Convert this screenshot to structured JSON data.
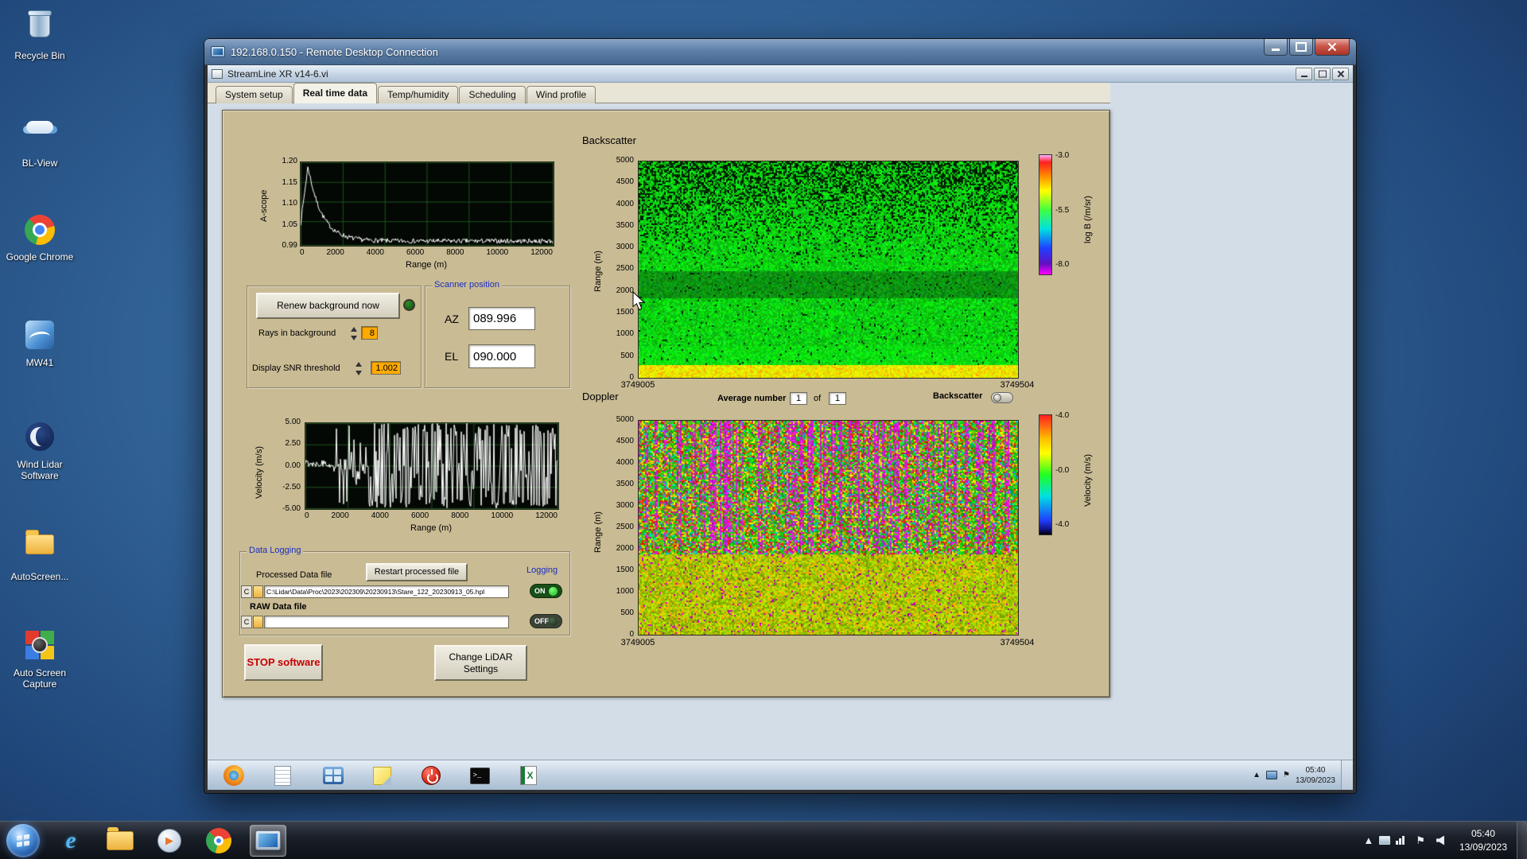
{
  "desktop": {
    "icons": [
      {
        "label": "Recycle Bin"
      },
      {
        "label": "BL-View"
      },
      {
        "label": "Google Chrome"
      },
      {
        "label": "MW41"
      },
      {
        "label": "Wind Lidar Software"
      },
      {
        "label": "AutoScreen..."
      },
      {
        "label": "Auto Screen Capture"
      }
    ]
  },
  "rdp_window": {
    "title": "192.168.0.150 - Remote Desktop Connection"
  },
  "vi_window": {
    "title": "StreamLine XR v14-6.vi",
    "tabs": [
      {
        "label": "System setup"
      },
      {
        "label": "Real time data",
        "active": true
      },
      {
        "label": "Temp/humidity"
      },
      {
        "label": "Scheduling"
      },
      {
        "label": "Wind profile"
      }
    ]
  },
  "background_controls": {
    "renew_button": "Renew background now",
    "rays_label": "Rays in background",
    "rays_value": "8",
    "snr_label": "Display SNR threshold",
    "snr_value": "1.002"
  },
  "scanner": {
    "title": "Scanner position",
    "az_label": "AZ",
    "az_value": "089.996",
    "el_label": "EL",
    "el_value": "090.000"
  },
  "data_logging": {
    "title": "Data Logging",
    "processed_label": "Processed Data file",
    "restart_button": "Restart processed file",
    "logging_label": "Logging",
    "drive_letter": "C",
    "processed_path": "C:\\Lidar\\Data\\Proc\\2023\\202309\\20230913\\Stare_122_20230913_05.hpl",
    "on_label": "ON",
    "raw_label": "RAW Data file",
    "raw_path": "",
    "off_label": "OFF"
  },
  "action_buttons": {
    "stop": "STOP software",
    "change_settings": "Change LiDAR Settings"
  },
  "doppler_header": {
    "average_label": "Average number",
    "average_value": "1",
    "of_label": "of",
    "of_value": "1",
    "backscatter_label": "Backscatter"
  },
  "chart_data": [
    {
      "type": "line",
      "title": "A-scope",
      "ylabel": "A-scope",
      "xlabel": "Range (m)",
      "xlim": [
        0,
        12000
      ],
      "ylim": [
        0.99,
        1.2
      ],
      "xticks": [
        "0",
        "2000",
        "4000",
        "6000",
        "8000",
        "10000",
        "12000"
      ],
      "yticks": [
        "1.20",
        "1.15",
        "1.10",
        "1.05",
        "0.99"
      ],
      "grid": true,
      "series": [
        {
          "name": "a-scope-trace",
          "color": "#ffffff",
          "description": "Rises from ~1.05 at 0 m to a peak of ~1.19 near 400 m, decays to a noisy ~1.00 baseline beyond 3000 m"
        }
      ]
    },
    {
      "type": "line",
      "title": "Velocity",
      "ylabel": "Velocity (m/s)",
      "xlabel": "Range (m)",
      "xlim": [
        0,
        12000
      ],
      "ylim": [
        -5,
        5
      ],
      "xticks": [
        "0",
        "2000",
        "4000",
        "6000",
        "8000",
        "10000",
        "12000"
      ],
      "yticks": [
        "5.00",
        "2.50",
        "0.00",
        "-2.50",
        "-5.00"
      ],
      "grid": true,
      "series": [
        {
          "name": "velocity-trace",
          "color": "#ffffff",
          "description": "Near 0 m/s below ~1500 m, noise grows to full-scale ±5 m/s saturation beyond ~3000 m"
        }
      ]
    },
    {
      "type": "heatmap",
      "title": "Backscatter",
      "ylabel": "Range (m)",
      "ylim": [
        0,
        5000
      ],
      "yticks": [
        "5000",
        "4500",
        "4000",
        "3500",
        "3000",
        "2500",
        "2000",
        "1500",
        "1000",
        "500",
        "0"
      ],
      "xticks": [
        "3749005",
        "3749504"
      ],
      "colorbar": {
        "label": "log B (/m/sr)",
        "ticks": [
          "-3.0",
          "-5.5",
          "-8.0"
        ]
      },
      "description": "Time-height backscatter: solid green below ~2500 m with darker band near 2000-2500 m, increasing black speckle above 3000 m, bright yellow aerosol layer near 0-300 m"
    },
    {
      "type": "heatmap",
      "title": "Doppler",
      "ylabel": "Range (m)",
      "ylim": [
        0,
        5000
      ],
      "yticks": [
        "5000",
        "4500",
        "4000",
        "3500",
        "3000",
        "2500",
        "2000",
        "1500",
        "1000",
        "500",
        "0"
      ],
      "xticks": [
        "3749005",
        "3749504"
      ],
      "colorbar": {
        "label": "Velocity (m/s)",
        "ticks": [
          "-4.0",
          "-0.0",
          "-4.0"
        ]
      },
      "description": "Time-height Doppler velocity: noisy magenta/green/yellow vertical streaks above ~2000 m, smoother green-yellow with orange patches below"
    }
  ],
  "remote_taskbar": {
    "time": "05:40",
    "date": "13/09/2023",
    "tray_arrow": "▲",
    "flag_glyph": "⚑",
    "cmd_glyph": ">_",
    "excel_glyph": "X"
  },
  "host_taskbar": {
    "time": "05:40",
    "date": "13/09/2023",
    "ie_glyph": "e",
    "play_glyph": "▶",
    "tray_arrow": "▲",
    "flag_glyph": "⚑"
  },
  "colors": {
    "labview_panel_tan": "#c9bb94",
    "label_blue": "#1b2dbf",
    "value_orange": "#ffaa00",
    "logging_on_green": "#35c435",
    "stop_red": "#c40000"
  }
}
